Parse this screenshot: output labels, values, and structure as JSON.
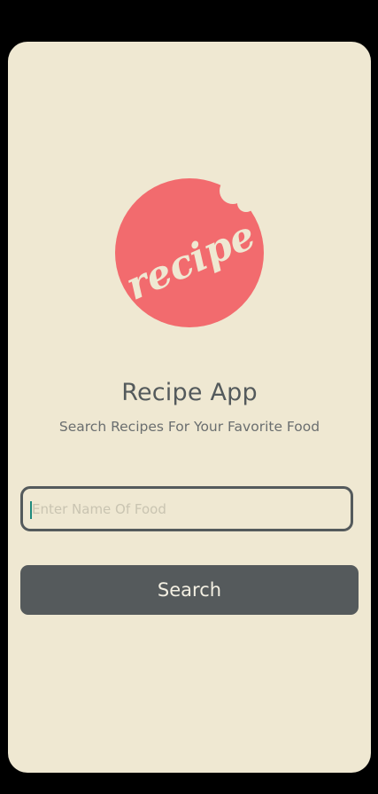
{
  "app": {
    "logo_text": "recipe",
    "title": "Recipe App",
    "subtitle": "Search Recipes For Your Favorite Food"
  },
  "search": {
    "placeholder": "Enter Name Of Food",
    "value": "",
    "button_label": "Search"
  },
  "colors": {
    "background": "#efe8d2",
    "logo_circle": "#f26b6e",
    "primary_dark": "#545a5c",
    "button_text": "#f3efe2",
    "caret": "#1f8a7d"
  }
}
